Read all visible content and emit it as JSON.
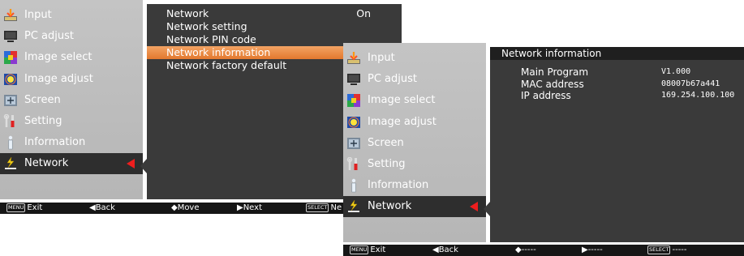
{
  "left_menu": {
    "items": [
      {
        "label": "Input",
        "icon": "input-icon"
      },
      {
        "label": "PC adjust",
        "icon": "pc-adjust-icon"
      },
      {
        "label": "Image select",
        "icon": "image-select-icon"
      },
      {
        "label": "Image adjust",
        "icon": "image-adjust-icon"
      },
      {
        "label": "Screen",
        "icon": "screen-icon"
      },
      {
        "label": "Setting",
        "icon": "setting-icon"
      },
      {
        "label": "Information",
        "icon": "information-icon"
      },
      {
        "label": "Network",
        "icon": "network-icon"
      }
    ],
    "selected_index": 7
  },
  "network_submenu": {
    "items": [
      {
        "label": "Network",
        "value": "On"
      },
      {
        "label": "Network setting",
        "value": ""
      },
      {
        "label": "Network PIN code",
        "value": ""
      },
      {
        "label": "Network information",
        "value": ""
      },
      {
        "label": "Network factory default",
        "value": ""
      }
    ],
    "highlighted_index": 3
  },
  "status_bar_1": {
    "exit_key": "MENU",
    "exit": "Exit",
    "back": "◀Back",
    "move": "◆Move",
    "next": "▶Next",
    "select_key": "SELECT",
    "select": "Ne"
  },
  "right_menu": {
    "items": [
      {
        "label": "Input",
        "icon": "input-icon"
      },
      {
        "label": "PC adjust",
        "icon": "pc-adjust-icon"
      },
      {
        "label": "Image select",
        "icon": "image-select-icon"
      },
      {
        "label": "Image adjust",
        "icon": "image-adjust-icon"
      },
      {
        "label": "Screen",
        "icon": "screen-icon"
      },
      {
        "label": "Setting",
        "icon": "setting-icon"
      },
      {
        "label": "Information",
        "icon": "information-icon"
      },
      {
        "label": "Network",
        "icon": "network-icon"
      }
    ],
    "selected_index": 7
  },
  "network_info": {
    "title": "Network information",
    "rows": [
      {
        "label": "Main Program",
        "value": "V1.000"
      },
      {
        "label": "MAC address",
        "value": "08007b67a441"
      },
      {
        "label": "IP address",
        "value": "169.254.100.100"
      }
    ]
  },
  "status_bar_2": {
    "exit_key": "MENU",
    "exit": "Exit",
    "back": "◀Back",
    "move": "◆-----",
    "next": "▶-----",
    "select_key": "SELECT",
    "select": "-----"
  },
  "colors": {
    "panel": "#bdbdbd",
    "dark": "#3a3a3a",
    "highlight": "#e8833a",
    "arrow": "#ee1e1e",
    "status": "#161616"
  }
}
